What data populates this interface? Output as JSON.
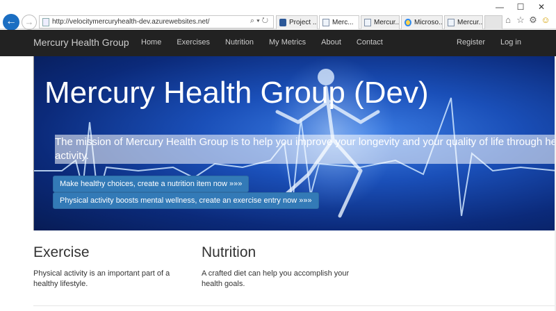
{
  "browser": {
    "address_url": "http://velocitymercuryhealth-dev.azurewebsites.net/",
    "tabs": [
      {
        "label": "Project ...",
        "icon": "project-icon"
      },
      {
        "label": "Merc...",
        "icon": "page-icon",
        "close": "✕"
      },
      {
        "label": "Mercur...",
        "icon": "page-icon"
      },
      {
        "label": "Microso...",
        "icon": "ie-icon"
      },
      {
        "label": "Mercur...",
        "icon": "page-icon"
      }
    ],
    "window_controls": {
      "minimize": "—",
      "maximize": "☐",
      "close": "✕"
    }
  },
  "navbar": {
    "brand": "Mercury Health Group",
    "links": [
      "Home",
      "Exercises",
      "Nutrition",
      "My Metrics",
      "About",
      "Contact"
    ],
    "right_links": [
      "Register",
      "Log in"
    ]
  },
  "hero": {
    "title": "Mercury Health Group (Dev)",
    "mission": "The mission of Mercury Health Group is to help you improve your longevity and your quality of life through he activity.",
    "cta_nutrition": "Make healthy choices, create a nutrition item now »»»",
    "cta_exercise": "Physical activity boosts mental wellness, create an exercise entry now »»»"
  },
  "sections": {
    "exercise": {
      "title": "Exercise",
      "text": "Physical activity is an important part of a healthy lifestyle."
    },
    "nutrition": {
      "title": "Nutrition",
      "text": "A crafted diet can help you accomplish your health goals."
    }
  },
  "colors": {
    "navbar_bg": "#222222",
    "button_primary": "#337ab7",
    "hero_blue": "#1a4fb8"
  }
}
